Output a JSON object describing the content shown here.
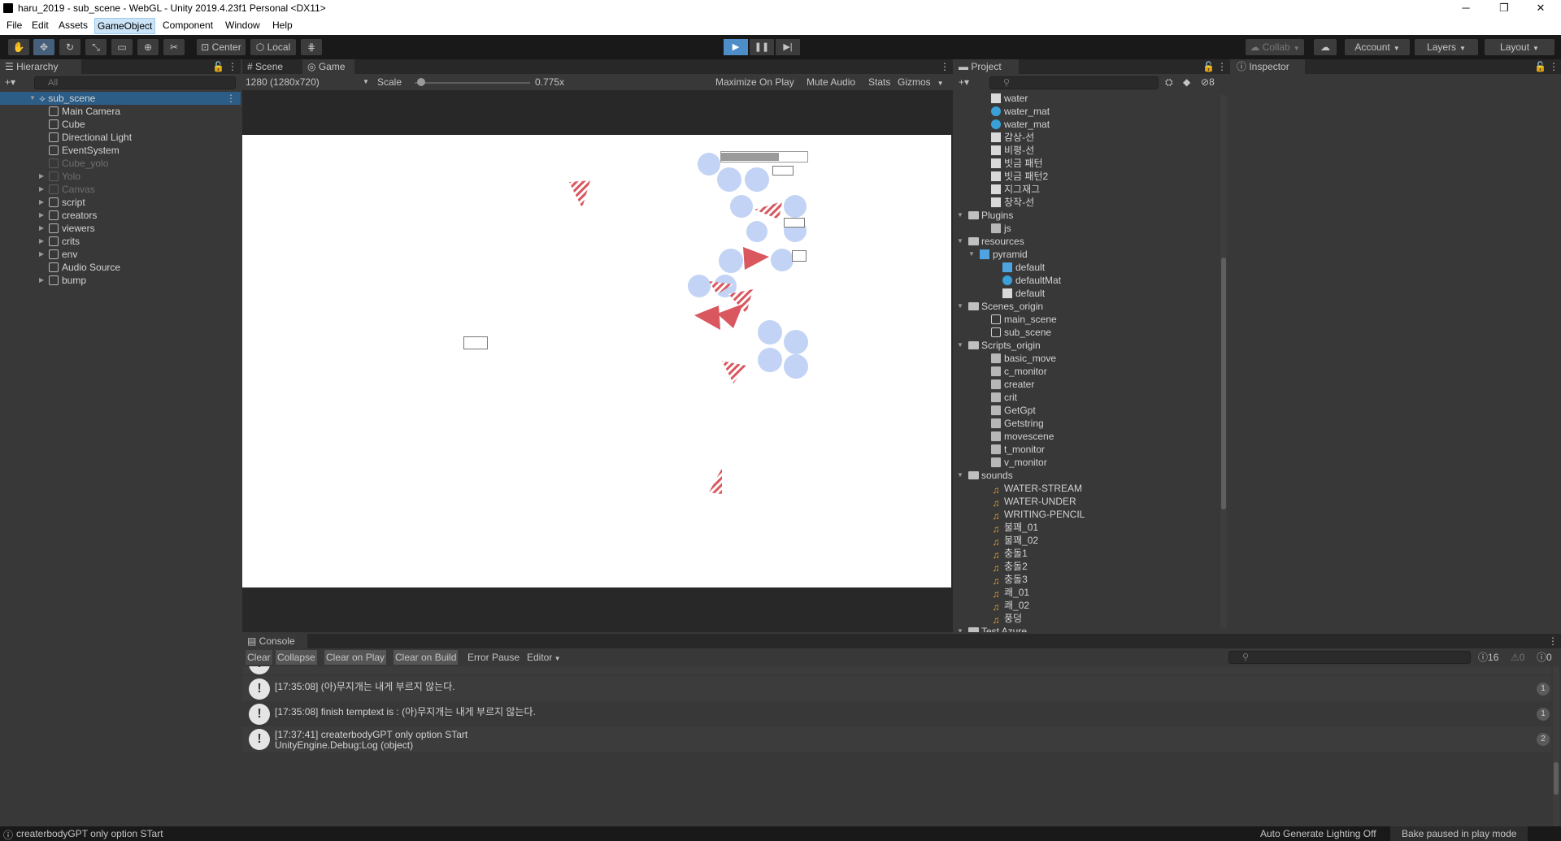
{
  "window": {
    "title": "haru_2019 - sub_scene - WebGL - Unity 2019.4.23f1 Personal <DX11>",
    "minimize": "─",
    "restore": "❐",
    "close": "✕"
  },
  "menu": [
    "File",
    "Edit",
    "Assets",
    "GameObject",
    "Component",
    "Window",
    "Help"
  ],
  "toolbar": {
    "center": "Center",
    "local": "Local",
    "collab": "Collab",
    "account": "Account",
    "layers": "Layers",
    "layout": "Layout",
    "play": "▶",
    "pause": "❚❚",
    "step": "▶|"
  },
  "hierarchy": {
    "tab": "Hierarchy",
    "search_placeholder": "All",
    "scene": "sub_scene",
    "items": [
      {
        "label": "Main Camera",
        "dim": false,
        "expandable": false
      },
      {
        "label": "Cube",
        "dim": false,
        "expandable": false
      },
      {
        "label": "Directional Light",
        "dim": false,
        "expandable": false
      },
      {
        "label": "EventSystem",
        "dim": false,
        "expandable": false
      },
      {
        "label": "Cube_yolo",
        "dim": true,
        "expandable": false
      },
      {
        "label": "Yolo",
        "dim": true,
        "expandable": true
      },
      {
        "label": "Canvas",
        "dim": true,
        "expandable": true
      },
      {
        "label": "script",
        "dim": false,
        "expandable": true
      },
      {
        "label": "creators",
        "dim": false,
        "expandable": true
      },
      {
        "label": "viewers",
        "dim": false,
        "expandable": true
      },
      {
        "label": "crits",
        "dim": false,
        "expandable": true
      },
      {
        "label": "env",
        "dim": false,
        "expandable": true
      },
      {
        "label": "Audio Source",
        "dim": false,
        "expandable": false
      },
      {
        "label": "bump",
        "dim": false,
        "expandable": true
      }
    ]
  },
  "gameview": {
    "tab_scene": "Scene",
    "tab_game": "Game",
    "resolution": "1280 (1280x720)",
    "scale_label": "Scale",
    "scale_value": "0.775x",
    "maximize": "Maximize On Play",
    "mute": "Mute Audio",
    "stats": "Stats",
    "gizmos": "Gizmos"
  },
  "project": {
    "tab": "Project",
    "hidden_count": "8",
    "items": [
      {
        "label": "water",
        "indent": 3,
        "icon": "tex"
      },
      {
        "label": "water_mat",
        "indent": 3,
        "icon": "mat"
      },
      {
        "label": "water_mat",
        "indent": 3,
        "icon": "mat"
      },
      {
        "label": "감상-선",
        "indent": 3,
        "icon": "tex"
      },
      {
        "label": "비평-선",
        "indent": 3,
        "icon": "tex"
      },
      {
        "label": "빗금 패턴",
        "indent": 3,
        "icon": "tex"
      },
      {
        "label": "빗금 패턴2",
        "indent": 3,
        "icon": "tex"
      },
      {
        "label": "지그재그",
        "indent": 3,
        "icon": "tex"
      },
      {
        "label": "창작-선",
        "indent": 3,
        "icon": "tex"
      },
      {
        "label": "Plugins",
        "indent": 1,
        "icon": "folder",
        "open": true
      },
      {
        "label": "js",
        "indent": 3,
        "icon": "scr"
      },
      {
        "label": "resources",
        "indent": 1,
        "icon": "folder",
        "open": true
      },
      {
        "label": "pyramid",
        "indent": 2,
        "icon": "mesh",
        "open": true
      },
      {
        "label": "default",
        "indent": 4,
        "icon": "mesh"
      },
      {
        "label": "defaultMat",
        "indent": 4,
        "icon": "mat"
      },
      {
        "label": "default",
        "indent": 4,
        "icon": "tex"
      },
      {
        "label": "Scenes_origin",
        "indent": 1,
        "icon": "folder",
        "open": true
      },
      {
        "label": "main_scene",
        "indent": 3,
        "icon": "scn"
      },
      {
        "label": "sub_scene",
        "indent": 3,
        "icon": "scn"
      },
      {
        "label": "Scripts_origin",
        "indent": 1,
        "icon": "folder",
        "open": true
      },
      {
        "label": "basic_move",
        "indent": 3,
        "icon": "scr"
      },
      {
        "label": "c_monitor",
        "indent": 3,
        "icon": "scr"
      },
      {
        "label": "creater",
        "indent": 3,
        "icon": "scr"
      },
      {
        "label": "crit",
        "indent": 3,
        "icon": "scr"
      },
      {
        "label": "GetGpt",
        "indent": 3,
        "icon": "scr"
      },
      {
        "label": "Getstring",
        "indent": 3,
        "icon": "scr"
      },
      {
        "label": "movescene",
        "indent": 3,
        "icon": "scr"
      },
      {
        "label": "t_monitor",
        "indent": 3,
        "icon": "scr"
      },
      {
        "label": "v_monitor",
        "indent": 3,
        "icon": "scr"
      },
      {
        "label": "sounds",
        "indent": 1,
        "icon": "folder",
        "open": true
      },
      {
        "label": "WATER-STREAM",
        "indent": 3,
        "icon": "snd"
      },
      {
        "label": "WATER-UNDER",
        "indent": 3,
        "icon": "snd"
      },
      {
        "label": "WRITING-PENCIL",
        "indent": 3,
        "icon": "snd"
      },
      {
        "label": "불꽤_01",
        "indent": 3,
        "icon": "snd"
      },
      {
        "label": "불꽤_02",
        "indent": 3,
        "icon": "snd"
      },
      {
        "label": "충돌1",
        "indent": 3,
        "icon": "snd"
      },
      {
        "label": "충돌2",
        "indent": 3,
        "icon": "snd"
      },
      {
        "label": "충돌3",
        "indent": 3,
        "icon": "snd"
      },
      {
        "label": "쾌_01",
        "indent": 3,
        "icon": "snd"
      },
      {
        "label": "쾌_02",
        "indent": 3,
        "icon": "snd"
      },
      {
        "label": "풍덩",
        "indent": 3,
        "icon": "snd"
      },
      {
        "label": "Test Azure",
        "indent": 1,
        "icon": "folder",
        "open": true
      }
    ]
  },
  "inspector": {
    "tab": "Inspector"
  },
  "console": {
    "tab": "Console",
    "buttons": [
      "Clear",
      "Collapse",
      "Clear on Play",
      "Clear on Build",
      "Error Pause",
      "Editor"
    ],
    "count_log": "16",
    "count_warn": "0",
    "count_err": "0",
    "rows": [
      {
        "line1": "[17:35:08] (아)무지개는 내게 부르지 않는다.",
        "line2": "",
        "count": "1"
      },
      {
        "line1": "[17:35:08] finish temptext is : (아)무지개는 내게 부르지 않는다.",
        "line2": "",
        "count": "1"
      },
      {
        "line1": "[17:37:41] createrbodyGPT only option STart",
        "line2": "UnityEngine.Debug:Log (object)",
        "count": "2"
      }
    ]
  },
  "status": {
    "message": "createrbodyGPT only option STart",
    "lighting": "Auto Generate Lighting Off",
    "bake": "Bake paused in play mode"
  }
}
